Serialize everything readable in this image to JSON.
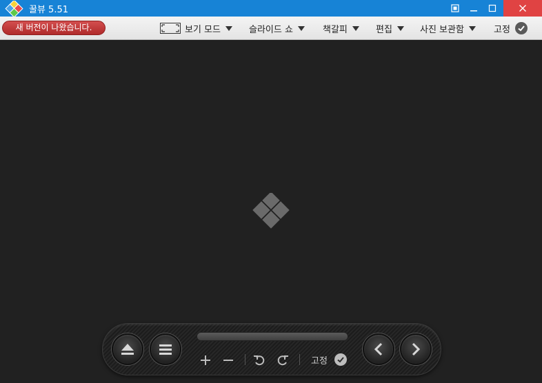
{
  "window": {
    "title": "꿀뷰 5.51",
    "titlebar_color": "#1783d6",
    "close_color": "#e04343"
  },
  "menubar": {
    "update_notice": "새 버전이 나왔습니다.",
    "view_mode": "보기 모드",
    "slideshow": "슬라이드 쇼",
    "bookmark": "책갈피",
    "edit": "편집",
    "photo_storage": "사진 보관함",
    "pin": "고정"
  },
  "controls": {
    "pin_label": "고정",
    "icons": [
      "eject-icon",
      "menu-icon",
      "zoom-in-icon",
      "zoom-out-icon",
      "rotate-left-icon",
      "rotate-right-icon",
      "check-icon",
      "previous-icon",
      "next-icon"
    ]
  }
}
